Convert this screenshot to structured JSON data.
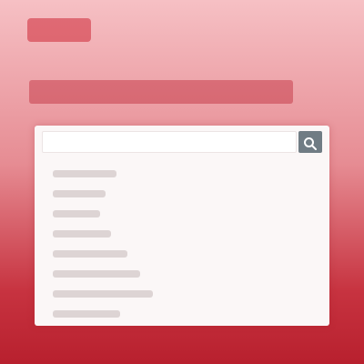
{
  "header": {
    "logo_text": "",
    "title": ""
  },
  "search": {
    "value": "",
    "placeholder": ""
  },
  "list": {
    "items": [
      {
        "label": ""
      },
      {
        "label": ""
      },
      {
        "label": ""
      },
      {
        "label": ""
      },
      {
        "label": ""
      },
      {
        "label": ""
      },
      {
        "label": ""
      },
      {
        "label": ""
      }
    ]
  },
  "colors": {
    "background_top": "#f6c0c4",
    "background_bottom": "#b8202e",
    "panel": "#fbf7f7",
    "search_button": "#707c84"
  },
  "icons": {
    "search_button": "search-icon"
  }
}
